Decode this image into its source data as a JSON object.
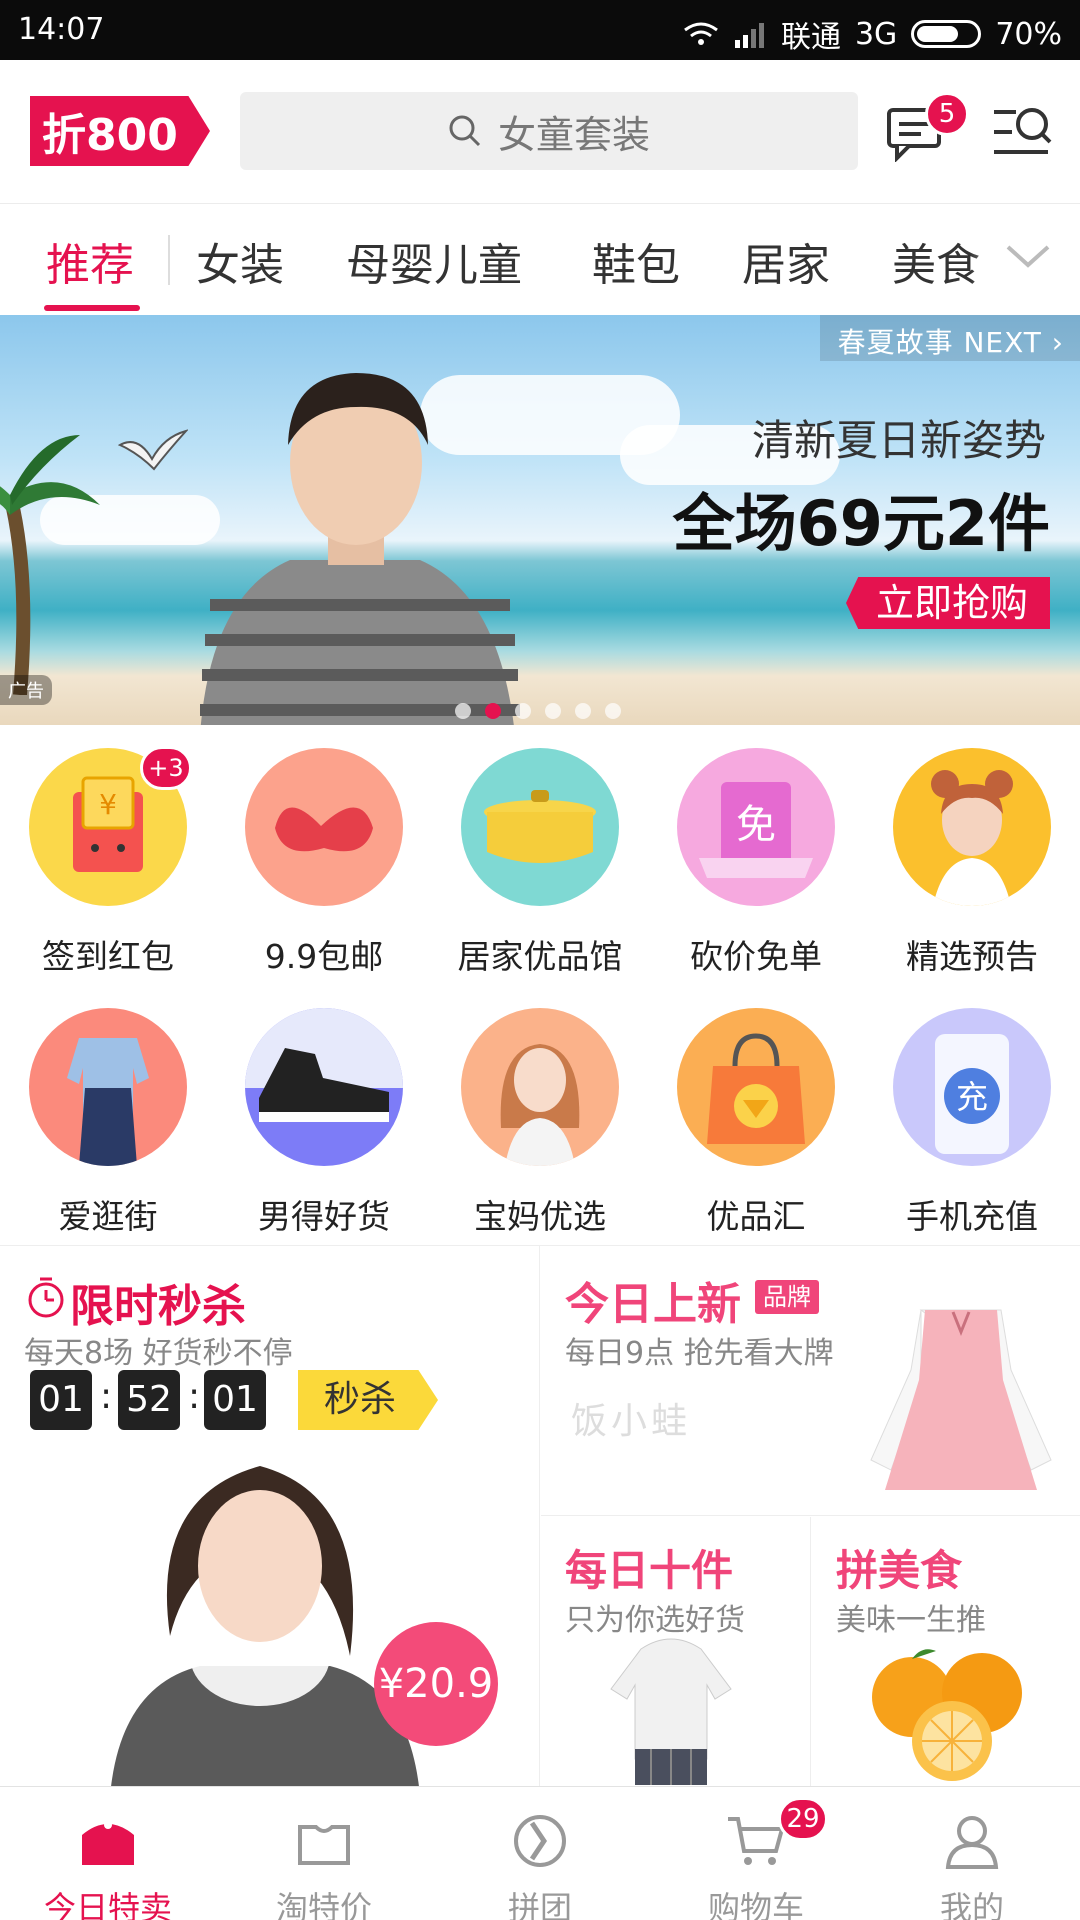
{
  "status_bar": {
    "time": "14:07",
    "carrier": "联通",
    "network": "3G",
    "battery": "70%",
    "battery_level": 0.7
  },
  "header": {
    "logo": "折800",
    "search_placeholder": "女童套装",
    "message_badge": "5",
    "icons": {
      "search": "search-icon",
      "message": "message-icon",
      "menu": "menu-search-icon"
    }
  },
  "tabs": {
    "items": [
      "推荐",
      "女装",
      "母婴儿童",
      "鞋包",
      "居家",
      "美食"
    ],
    "active": 0,
    "more_icon": "chevron-down-icon"
  },
  "banner": {
    "top_label": "春夏故事 NEXT ›",
    "subtitle": "清新夏日新姿势",
    "headline": "全场69元2件",
    "cta": "立即抢购",
    "ad_tag": "广告",
    "page_count": 6,
    "current_page": 1
  },
  "grid": {
    "items": [
      {
        "label": "签到红包",
        "badge": "+3",
        "color": "#fbd84a"
      },
      {
        "label": "9.9包邮",
        "color": "#fca28c"
      },
      {
        "label": "居家优品馆",
        "color": "#7fd9d3"
      },
      {
        "label": "砍价免单",
        "color": "#f6a9df"
      },
      {
        "label": "精选预告",
        "color": "#fbc02d"
      },
      {
        "label": "爱逛街",
        "color": "#fb8a7c"
      },
      {
        "label": "男得好货",
        "color": "#7d7cf7"
      },
      {
        "label": "宝妈优选",
        "color": "#fbb28a"
      },
      {
        "label": "优品汇",
        "color": "#fbae53"
      },
      {
        "label": "手机充值",
        "color": "#c9c8fb"
      }
    ]
  },
  "flash_sale": {
    "title": "限时秒杀",
    "subtitle": "每天8场 好货秒不停",
    "countdown": [
      "01",
      "52",
      "01"
    ],
    "button": "秒杀",
    "price": "¥20.9"
  },
  "new_today": {
    "title": "今日上新",
    "tag": "品牌",
    "subtitle": "每日9点 抢先看大牌",
    "brand": "饭小蛙"
  },
  "daily_ten": {
    "title": "每日十件",
    "subtitle": "只为你选好货"
  },
  "group_food": {
    "title": "拼美食",
    "subtitle": "美味一生推"
  },
  "bottom_nav": {
    "items": [
      {
        "label": "今日特卖",
        "icon": "bag-icon"
      },
      {
        "label": "淘特价",
        "icon": "tag-icon"
      },
      {
        "label": "拼团",
        "icon": "group-icon"
      },
      {
        "label": "购物车",
        "icon": "cart-icon",
        "badge": "29"
      },
      {
        "label": "我的",
        "icon": "user-icon"
      }
    ],
    "active": 0
  },
  "colors": {
    "accent": "#e5124f",
    "pink": "#f0457a",
    "yellow": "#fbd93a"
  }
}
